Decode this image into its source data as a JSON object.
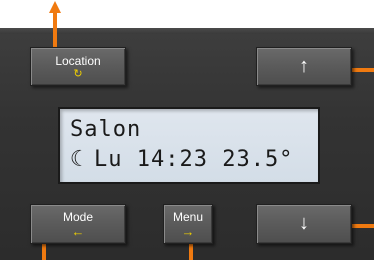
{
  "colors": {
    "panel": "#333333",
    "lcd": "#d8e1ea",
    "accent": "#f07a10",
    "hint": "#f0d000"
  },
  "buttons": {
    "location": {
      "label": "Location",
      "icon": "rotate-icon",
      "glyph": "↻"
    },
    "up": {
      "icon": "arrow-up-icon",
      "glyph": "↑"
    },
    "mode": {
      "label": "Mode",
      "icon": "arrow-left-icon",
      "glyph": "←"
    },
    "menu": {
      "label": "Menu",
      "icon": "arrow-right-icon",
      "glyph": "→"
    },
    "down": {
      "icon": "arrow-down-icon",
      "glyph": "↓"
    }
  },
  "display": {
    "line1": "Salon",
    "moon_glyph": "☾",
    "line2": "Lu 14:23 23.5°"
  }
}
